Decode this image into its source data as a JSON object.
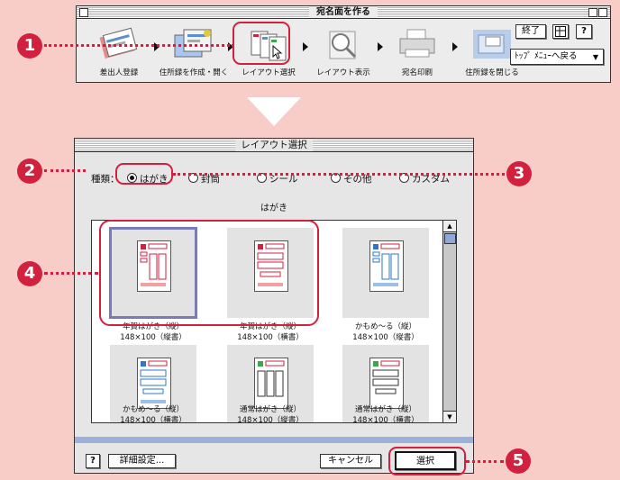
{
  "toolbar_window": {
    "title": "宛名面を作る",
    "steps": [
      {
        "label": "差出人登録",
        "icon": "sender-book-icon"
      },
      {
        "label": "住所録を作成・開く",
        "icon": "address-book-icon"
      },
      {
        "label": "レイアウト選択",
        "icon": "layout-cards-icon"
      },
      {
        "label": "レイアウト表示",
        "icon": "magnifier-icon"
      },
      {
        "label": "宛名印刷",
        "icon": "printer-icon"
      },
      {
        "label": "住所録を閉じる",
        "icon": "close-folder-icon"
      }
    ],
    "quit_label": "終了",
    "help_label": "?",
    "top_menu_label": "ﾄｯﾌﾟ ﾒﾆｭｰへ戻る"
  },
  "callouts": [
    "1",
    "2",
    "3",
    "4",
    "5"
  ],
  "dialog": {
    "title": "レイアウト選択",
    "kind_label": "種類：",
    "kind_options": [
      "はがき",
      "封筒",
      "シール",
      "その他",
      "カスタム"
    ],
    "selected_kind": "はがき",
    "section_title": "はがき",
    "layouts": [
      {
        "name": "年賀はがき（縦）",
        "size": "148×100（縦書）"
      },
      {
        "name": "年賀はがき（縦）",
        "size": "148×100（横書）"
      },
      {
        "name": "かもめ～る（縦）",
        "size": "148×100（縦書）"
      },
      {
        "name": "かもめ～る（縦）",
        "size": "148×100（横書）"
      },
      {
        "name": "通常はがき（縦）",
        "size": "148×100（縦書）"
      },
      {
        "name": "通常はがき（縦）",
        "size": "148×100（横書）"
      }
    ],
    "help_label": "?",
    "detail_label": "詳細設定...",
    "cancel_label": "キャンセル",
    "select_label": "選択"
  },
  "colors": {
    "accent": "#d2203f",
    "background": "#f8cdc7",
    "selection": "#7a7ab8"
  }
}
